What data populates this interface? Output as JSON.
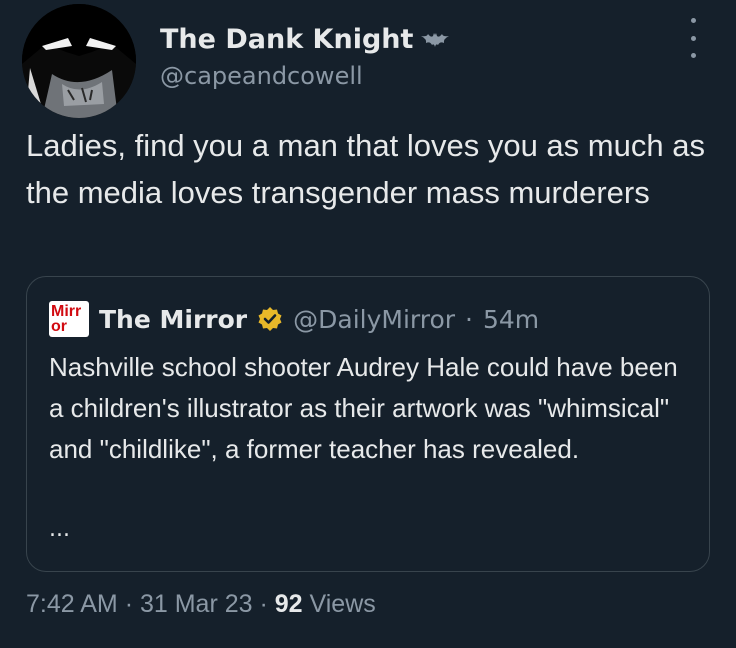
{
  "tweet": {
    "display_name": "The Dank Knight",
    "handle": "@capeandcowell",
    "text": "Ladies, find you a man that loves you as much as the media loves transgender mass murderers",
    "time": "7:42 AM",
    "date": "31 Mar 23",
    "views_count": "92",
    "views_label": "Views"
  },
  "quote": {
    "logo_line1": "Mirr",
    "logo_line2": "or",
    "display_name": "The Mirror",
    "handle": "@DailyMirror",
    "separator": "·",
    "time": "54m",
    "text": "Nashville school shooter Audrey Hale could have been a children's illustrator as their artwork was \"whimsical\" and \"childlike\", a former teacher has revealed.",
    "ellipsis": "..."
  },
  "icons": {
    "badge": "bat-icon",
    "verified": "verified-gold-badge-icon",
    "menu": "more-options-icon"
  },
  "colors": {
    "background": "#15202b",
    "text": "#e7e9ea",
    "secondary": "#8b98a5",
    "border": "#38444d",
    "verified_gold": "#e8b829",
    "mirror_red": "#d10a10"
  }
}
